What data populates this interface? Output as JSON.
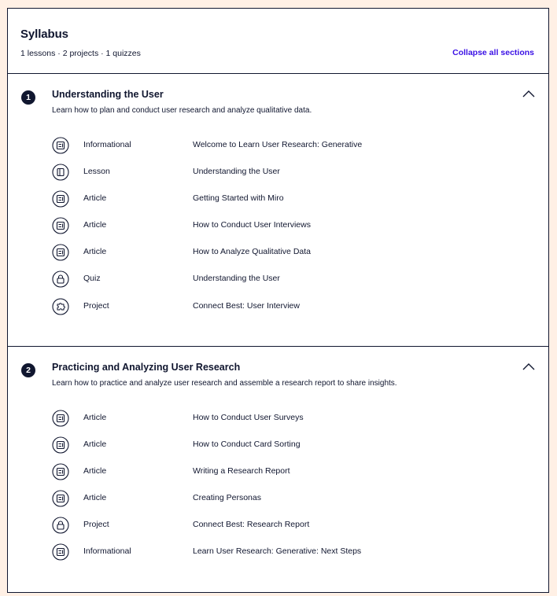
{
  "syllabus": {
    "title": "Syllabus",
    "meta": "1 lessons · 2 projects · 1 quizzes",
    "collapse_label": "Collapse all sections"
  },
  "sections": [
    {
      "number": "1",
      "title": "Understanding the User",
      "description": "Learn how to plan and conduct user research and analyze qualitative data.",
      "items": [
        {
          "icon": "article-icon",
          "type": "Informational",
          "name": "Welcome to Learn User Research: Generative"
        },
        {
          "icon": "lesson-icon",
          "type": "Lesson",
          "name": "Understanding the User"
        },
        {
          "icon": "article-icon",
          "type": "Article",
          "name": "Getting Started with Miro"
        },
        {
          "icon": "article-icon",
          "type": "Article",
          "name": "How to Conduct User Interviews"
        },
        {
          "icon": "article-icon",
          "type": "Article",
          "name": "How to Analyze Qualitative Data"
        },
        {
          "icon": "lock-icon",
          "type": "Quiz",
          "name": "Understanding the User"
        },
        {
          "icon": "puzzle-icon",
          "type": "Project",
          "name": "Connect Best: User Interview"
        }
      ]
    },
    {
      "number": "2",
      "title": "Practicing and Analyzing User Research",
      "description": "Learn how to practice and analyze user research and assemble a research report to share insights.",
      "items": [
        {
          "icon": "article-icon",
          "type": "Article",
          "name": "How to Conduct User Surveys"
        },
        {
          "icon": "article-icon",
          "type": "Article",
          "name": "How to Conduct Card Sorting"
        },
        {
          "icon": "article-icon",
          "type": "Article",
          "name": "Writing a Research Report"
        },
        {
          "icon": "article-icon",
          "type": "Article",
          "name": "Creating Personas"
        },
        {
          "icon": "lock-icon",
          "type": "Project",
          "name": "Connect Best: Research Report"
        },
        {
          "icon": "article-icon",
          "type": "Informational",
          "name": "Learn User Research: Generative: Next Steps"
        }
      ]
    }
  ],
  "colors": {
    "page_bg": "#fff0e5",
    "ink": "#10162f",
    "link": "#3a10e5"
  }
}
